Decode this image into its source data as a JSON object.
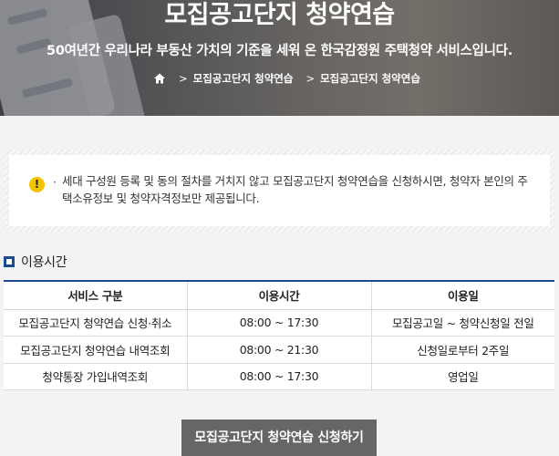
{
  "hero": {
    "title": "모집공고단지 청약연습",
    "subtitle": "50여년간 우리나라 부동산 가치의 기준을 세워 온 한국감정원 주택청약 서비스입니다.",
    "breadcrumb": [
      "모집공고단지 청약연습",
      "모집공고단지 청약연습"
    ]
  },
  "notice": {
    "icon": "warning-icon",
    "text": "세대 구성원 등록 및 동의 절차를 거치지 않고 모집공고단지 청약연습을 신청하시면, 청약자 본인의 주택소유정보 및 청약자격정보만 제공됩니다."
  },
  "section": {
    "title": "이용시간"
  },
  "table": {
    "headers": [
      "서비스 구분",
      "이용시간",
      "이용일"
    ],
    "rows": [
      [
        "모집공고단지 청약연습 신청·취소",
        "08:00 ~ 17:30",
        "모집공고일 ~ 청약신청일 전일"
      ],
      [
        "모집공고단지 청약연습 내역조회",
        "08:00 ~ 21:30",
        "신청일로부터 2주일"
      ],
      [
        "청약통장 가입내역조회",
        "08:00 ~ 17:30",
        "영업일"
      ]
    ]
  },
  "cta": {
    "label": "모집공고단지 청약연습 신청하기"
  },
  "colors": {
    "accent": "#1d4a8f",
    "warning": "#f5c400",
    "button": "#666666"
  }
}
